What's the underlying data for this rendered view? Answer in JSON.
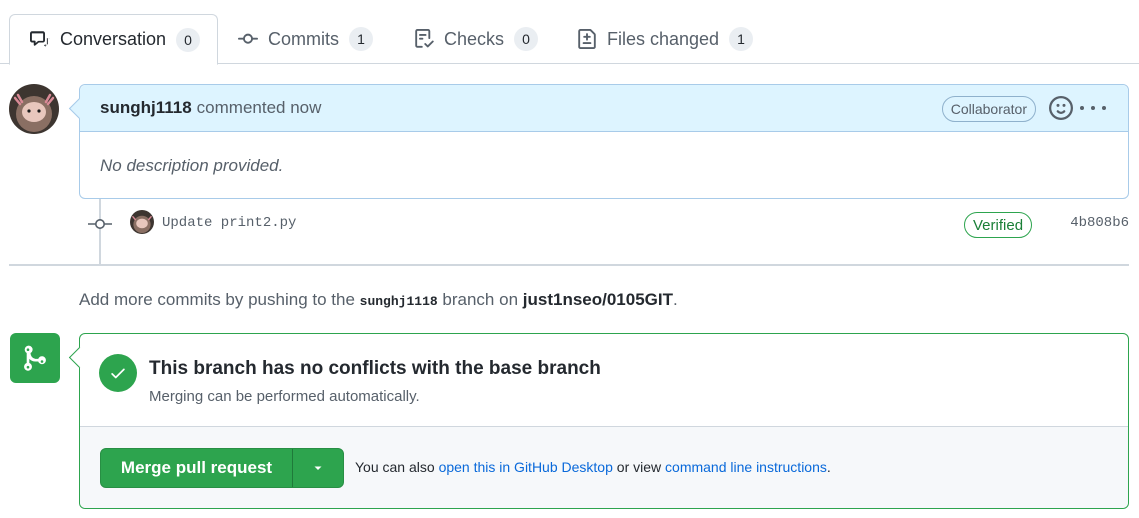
{
  "tabs": [
    {
      "label": "Conversation",
      "count": "0",
      "icon": "comment-discussion-icon",
      "active": true
    },
    {
      "label": "Commits",
      "count": "1",
      "icon": "git-commit-icon"
    },
    {
      "label": "Checks",
      "count": "0",
      "icon": "checklist-icon"
    },
    {
      "label": "Files changed",
      "count": "1",
      "icon": "file-diff-icon"
    }
  ],
  "comment": {
    "author": "sunghj1118",
    "meta": "commented now",
    "badge": "Collaborator",
    "body": "No description provided."
  },
  "commit": {
    "message": "Update print2.py",
    "badge": "Verified",
    "sha": "4b808b6"
  },
  "hint": {
    "prefix": "Add more commits by pushing to the",
    "branch": "sunghj1118",
    "middle": "branch on",
    "repo": "just1nseo/0105GIT",
    "suffix": "."
  },
  "merge": {
    "title": "This branch has no conflicts with the base branch",
    "subtitle": "Merging can be performed automatically.",
    "button": "Merge pull request",
    "note_prefix": "You can also",
    "link1": "open this in GitHub Desktop",
    "note_middle": "or view",
    "link2": "command line instructions",
    "note_suffix": "."
  },
  "colors": {
    "green": "#2da44e",
    "blue_link": "#0969da",
    "header_blue": "#ddf4ff"
  }
}
